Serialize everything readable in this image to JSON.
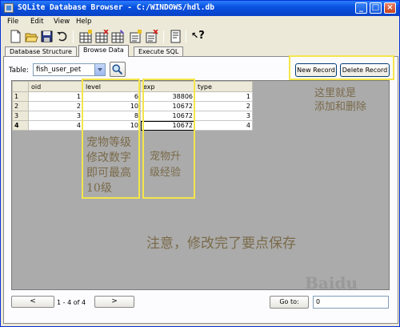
{
  "window": {
    "title": "SQLite Database Browser - C:/WINDOWS/hdl.db",
    "minimize": "_",
    "maximize": "□",
    "close": "×"
  },
  "menu": [
    "File",
    "Edit",
    "View",
    "Help"
  ],
  "toolbar": {
    "icons": [
      "new-database-icon",
      "open-database-icon",
      "save-icon",
      "undo-icon",
      "create-table-icon",
      "delete-table-icon",
      "modify-table-icon",
      "create-index-icon",
      "delete-index-icon",
      "query-icon",
      "whats-this-icon"
    ],
    "whats_this": "?"
  },
  "tabs": [
    "Database Structure",
    "Browse Data",
    "Execute SQL"
  ],
  "browse": {
    "table_label": "Table:",
    "table_value": "fish_user_pet",
    "new_record": "New Record",
    "delete_record": "Delete Record"
  },
  "grid": {
    "columns": [
      "oid",
      "level",
      "exp",
      "type"
    ],
    "rows": [
      {
        "num": "1",
        "oid": "1",
        "level": "6",
        "exp": "38806",
        "type": "1"
      },
      {
        "num": "2",
        "oid": "2",
        "level": "10",
        "exp": "10672",
        "type": "2"
      },
      {
        "num": "3",
        "oid": "3",
        "level": "8",
        "exp": "10672",
        "type": "3"
      },
      {
        "num": "4",
        "oid": "4",
        "level": "10",
        "exp": "10672",
        "type": "4"
      }
    ]
  },
  "annotations": {
    "add_delete": [
      "这里就是",
      "添加和删除"
    ],
    "level_note": [
      "宠物等级",
      "修改数字",
      "即可最高",
      "10级"
    ],
    "exp_note": [
      "宠物升",
      "级经验"
    ],
    "save_note": "注意，修改完了要点保存"
  },
  "pager": {
    "prev": "<",
    "next": ">",
    "range": "1 - 4 of 4",
    "goto": "Go to:",
    "goto_value": "0"
  },
  "watermark": "Baidu",
  "colors": {
    "titlebar": "#0a52e0",
    "annotation_box": "#f4e64a",
    "annotation_text": "#7a6a4a",
    "window_bg": "#ece9d8"
  }
}
